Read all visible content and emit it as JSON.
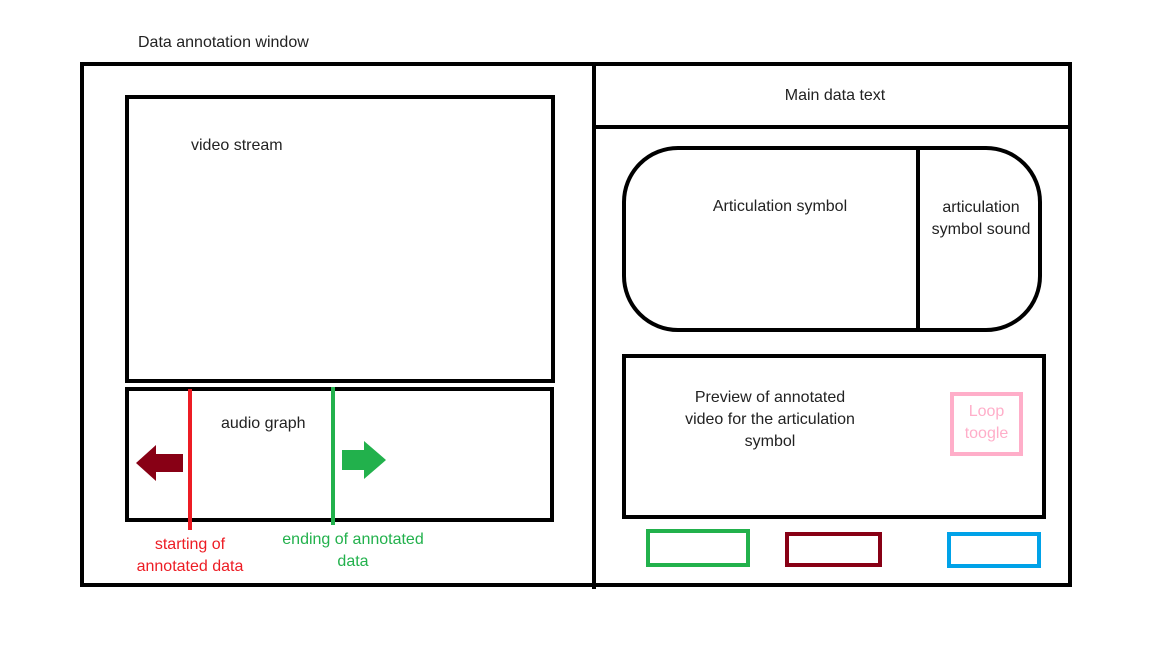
{
  "window": {
    "title": "Data annotation window"
  },
  "left_panel": {
    "video": {
      "label": "video stream"
    },
    "audio": {
      "label": "audio graph"
    },
    "start_marker": {
      "label_line1": "starting of",
      "label_line2": "annotated data",
      "color": "#ED1C24"
    },
    "end_marker": {
      "label_line1": "ending of annotated",
      "label_line2": "data",
      "color": "#22B14C"
    },
    "left_arrow": {
      "icon": "arrow-left-icon",
      "color": "#880015"
    },
    "right_arrow": {
      "icon": "arrow-right-icon",
      "color": "#22B14C"
    }
  },
  "right_panel": {
    "main_text": {
      "label": "Main data text"
    },
    "symbol": {
      "label": "Articulation symbol"
    },
    "symbol_sound": {
      "label_line1": "articulation",
      "label_line2": "symbol sound"
    },
    "preview": {
      "label_line1": "Preview of annotated",
      "label_line2": "video for the articulation",
      "label_line3": "symbol"
    },
    "loop_toggle": {
      "label_line1": "Loop",
      "label_line2": "toogle",
      "color": "#FFAEC9"
    },
    "buttons": {
      "green_color": "#22B14C",
      "dark_red_color": "#880015",
      "blue_color": "#00A2E8"
    }
  }
}
